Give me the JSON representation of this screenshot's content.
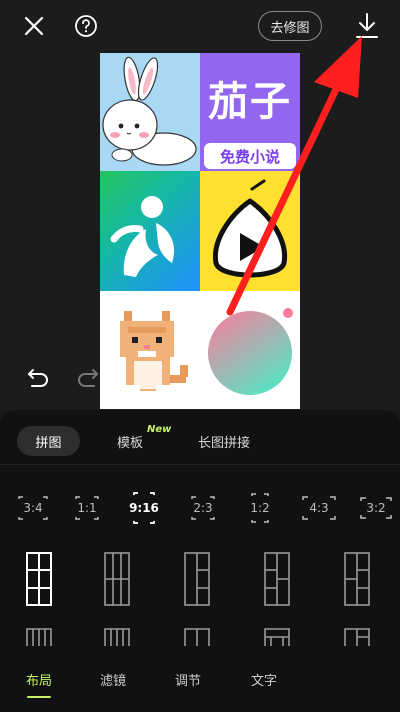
{
  "topbar": {
    "retouch_label": "去修图"
  },
  "collage": {
    "brand_title": "茄子",
    "brand_subtitle": "免费小说"
  },
  "tabs": [
    {
      "label": "拼图",
      "selected": true
    },
    {
      "label": "模板",
      "badge": "New",
      "selected": false
    },
    {
      "label": "长图拼接",
      "selected": false
    }
  ],
  "ratios": [
    {
      "label": "3:4",
      "selected": false
    },
    {
      "label": "1:1",
      "selected": false
    },
    {
      "label": "9:16",
      "selected": true
    },
    {
      "label": "2:3",
      "selected": false
    },
    {
      "label": "1:2",
      "selected": false
    },
    {
      "label": "4:3",
      "selected": false
    },
    {
      "label": "3:2",
      "selected": false
    }
  ],
  "bottom_nav": [
    {
      "label": "布局",
      "selected": true
    },
    {
      "label": "滤镜",
      "selected": false
    },
    {
      "label": "调节",
      "selected": false
    },
    {
      "label": "文字",
      "selected": false
    }
  ],
  "colors": {
    "accent": "#c8f26a",
    "annotation_arrow": "#ff1f1f",
    "brand_purple": "#9366f0"
  },
  "icons": [
    "close-icon",
    "help-icon",
    "download-icon",
    "undo-icon",
    "redo-icon"
  ]
}
